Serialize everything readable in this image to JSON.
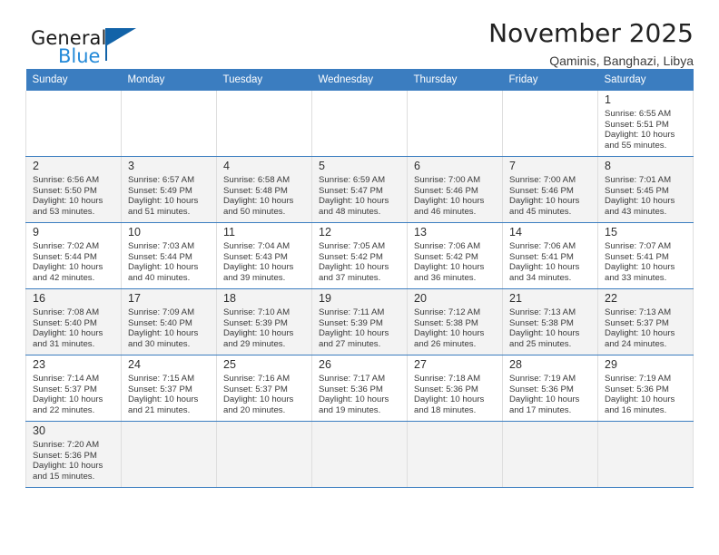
{
  "brand": {
    "line1": "General",
    "line2": "Blue",
    "flag_icon": "blue-flag-triangle",
    "accent_color": "#1263a8",
    "blue_text_color": "#2389d8"
  },
  "header": {
    "title": "November 2025",
    "subtitle": "Qaminis, Banghazi, Libya"
  },
  "calendar": {
    "header_bg_color": "#3b7dc0",
    "weekdays": [
      "Sunday",
      "Monday",
      "Tuesday",
      "Wednesday",
      "Thursday",
      "Friday",
      "Saturday"
    ],
    "weeks": [
      [
        {
          "day": "",
          "empty": true
        },
        {
          "day": "",
          "empty": true
        },
        {
          "day": "",
          "empty": true
        },
        {
          "day": "",
          "empty": true
        },
        {
          "day": "",
          "empty": true
        },
        {
          "day": "",
          "empty": true
        },
        {
          "day": "1",
          "sunrise": "Sunrise: 6:55 AM",
          "sunset": "Sunset: 5:51 PM",
          "daylight1": "Daylight: 10 hours",
          "daylight2": "and 55 minutes."
        }
      ],
      [
        {
          "day": "2",
          "sunrise": "Sunrise: 6:56 AM",
          "sunset": "Sunset: 5:50 PM",
          "daylight1": "Daylight: 10 hours",
          "daylight2": "and 53 minutes."
        },
        {
          "day": "3",
          "sunrise": "Sunrise: 6:57 AM",
          "sunset": "Sunset: 5:49 PM",
          "daylight1": "Daylight: 10 hours",
          "daylight2": "and 51 minutes."
        },
        {
          "day": "4",
          "sunrise": "Sunrise: 6:58 AM",
          "sunset": "Sunset: 5:48 PM",
          "daylight1": "Daylight: 10 hours",
          "daylight2": "and 50 minutes."
        },
        {
          "day": "5",
          "sunrise": "Sunrise: 6:59 AM",
          "sunset": "Sunset: 5:47 PM",
          "daylight1": "Daylight: 10 hours",
          "daylight2": "and 48 minutes."
        },
        {
          "day": "6",
          "sunrise": "Sunrise: 7:00 AM",
          "sunset": "Sunset: 5:46 PM",
          "daylight1": "Daylight: 10 hours",
          "daylight2": "and 46 minutes."
        },
        {
          "day": "7",
          "sunrise": "Sunrise: 7:00 AM",
          "sunset": "Sunset: 5:46 PM",
          "daylight1": "Daylight: 10 hours",
          "daylight2": "and 45 minutes."
        },
        {
          "day": "8",
          "sunrise": "Sunrise: 7:01 AM",
          "sunset": "Sunset: 5:45 PM",
          "daylight1": "Daylight: 10 hours",
          "daylight2": "and 43 minutes."
        }
      ],
      [
        {
          "day": "9",
          "sunrise": "Sunrise: 7:02 AM",
          "sunset": "Sunset: 5:44 PM",
          "daylight1": "Daylight: 10 hours",
          "daylight2": "and 42 minutes."
        },
        {
          "day": "10",
          "sunrise": "Sunrise: 7:03 AM",
          "sunset": "Sunset: 5:44 PM",
          "daylight1": "Daylight: 10 hours",
          "daylight2": "and 40 minutes."
        },
        {
          "day": "11",
          "sunrise": "Sunrise: 7:04 AM",
          "sunset": "Sunset: 5:43 PM",
          "daylight1": "Daylight: 10 hours",
          "daylight2": "and 39 minutes."
        },
        {
          "day": "12",
          "sunrise": "Sunrise: 7:05 AM",
          "sunset": "Sunset: 5:42 PM",
          "daylight1": "Daylight: 10 hours",
          "daylight2": "and 37 minutes."
        },
        {
          "day": "13",
          "sunrise": "Sunrise: 7:06 AM",
          "sunset": "Sunset: 5:42 PM",
          "daylight1": "Daylight: 10 hours",
          "daylight2": "and 36 minutes."
        },
        {
          "day": "14",
          "sunrise": "Sunrise: 7:06 AM",
          "sunset": "Sunset: 5:41 PM",
          "daylight1": "Daylight: 10 hours",
          "daylight2": "and 34 minutes."
        },
        {
          "day": "15",
          "sunrise": "Sunrise: 7:07 AM",
          "sunset": "Sunset: 5:41 PM",
          "daylight1": "Daylight: 10 hours",
          "daylight2": "and 33 minutes."
        }
      ],
      [
        {
          "day": "16",
          "sunrise": "Sunrise: 7:08 AM",
          "sunset": "Sunset: 5:40 PM",
          "daylight1": "Daylight: 10 hours",
          "daylight2": "and 31 minutes."
        },
        {
          "day": "17",
          "sunrise": "Sunrise: 7:09 AM",
          "sunset": "Sunset: 5:40 PM",
          "daylight1": "Daylight: 10 hours",
          "daylight2": "and 30 minutes."
        },
        {
          "day": "18",
          "sunrise": "Sunrise: 7:10 AM",
          "sunset": "Sunset: 5:39 PM",
          "daylight1": "Daylight: 10 hours",
          "daylight2": "and 29 minutes."
        },
        {
          "day": "19",
          "sunrise": "Sunrise: 7:11 AM",
          "sunset": "Sunset: 5:39 PM",
          "daylight1": "Daylight: 10 hours",
          "daylight2": "and 27 minutes."
        },
        {
          "day": "20",
          "sunrise": "Sunrise: 7:12 AM",
          "sunset": "Sunset: 5:38 PM",
          "daylight1": "Daylight: 10 hours",
          "daylight2": "and 26 minutes."
        },
        {
          "day": "21",
          "sunrise": "Sunrise: 7:13 AM",
          "sunset": "Sunset: 5:38 PM",
          "daylight1": "Daylight: 10 hours",
          "daylight2": "and 25 minutes."
        },
        {
          "day": "22",
          "sunrise": "Sunrise: 7:13 AM",
          "sunset": "Sunset: 5:37 PM",
          "daylight1": "Daylight: 10 hours",
          "daylight2": "and 24 minutes."
        }
      ],
      [
        {
          "day": "23",
          "sunrise": "Sunrise: 7:14 AM",
          "sunset": "Sunset: 5:37 PM",
          "daylight1": "Daylight: 10 hours",
          "daylight2": "and 22 minutes."
        },
        {
          "day": "24",
          "sunrise": "Sunrise: 7:15 AM",
          "sunset": "Sunset: 5:37 PM",
          "daylight1": "Daylight: 10 hours",
          "daylight2": "and 21 minutes."
        },
        {
          "day": "25",
          "sunrise": "Sunrise: 7:16 AM",
          "sunset": "Sunset: 5:37 PM",
          "daylight1": "Daylight: 10 hours",
          "daylight2": "and 20 minutes."
        },
        {
          "day": "26",
          "sunrise": "Sunrise: 7:17 AM",
          "sunset": "Sunset: 5:36 PM",
          "daylight1": "Daylight: 10 hours",
          "daylight2": "and 19 minutes."
        },
        {
          "day": "27",
          "sunrise": "Sunrise: 7:18 AM",
          "sunset": "Sunset: 5:36 PM",
          "daylight1": "Daylight: 10 hours",
          "daylight2": "and 18 minutes."
        },
        {
          "day": "28",
          "sunrise": "Sunrise: 7:19 AM",
          "sunset": "Sunset: 5:36 PM",
          "daylight1": "Daylight: 10 hours",
          "daylight2": "and 17 minutes."
        },
        {
          "day": "29",
          "sunrise": "Sunrise: 7:19 AM",
          "sunset": "Sunset: 5:36 PM",
          "daylight1": "Daylight: 10 hours",
          "daylight2": "and 16 minutes."
        }
      ],
      [
        {
          "day": "30",
          "sunrise": "Sunrise: 7:20 AM",
          "sunset": "Sunset: 5:36 PM",
          "daylight1": "Daylight: 10 hours",
          "daylight2": "and 15 minutes."
        },
        {
          "day": "",
          "empty": true
        },
        {
          "day": "",
          "empty": true
        },
        {
          "day": "",
          "empty": true
        },
        {
          "day": "",
          "empty": true
        },
        {
          "day": "",
          "empty": true
        },
        {
          "day": "",
          "empty": true
        }
      ]
    ]
  }
}
